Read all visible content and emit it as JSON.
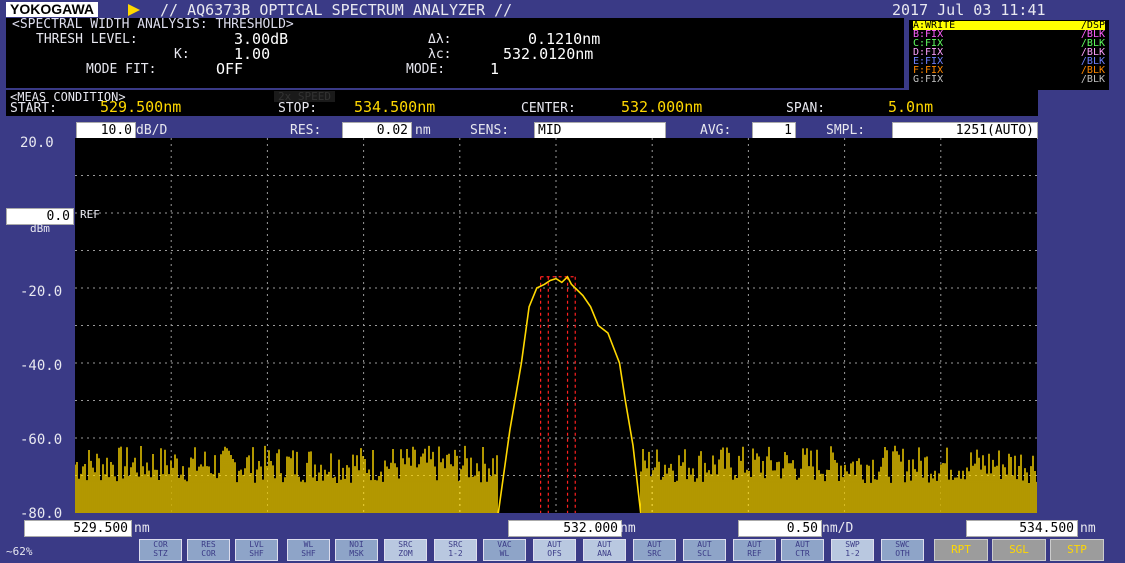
{
  "header": {
    "brand": "YOKOGAWA",
    "title": "// AQ6373B OPTICAL SPECTRUM ANALYZER //",
    "datetime": "2017 Jul 03 11:41"
  },
  "analysis": {
    "heading": "<SPECTRAL WIDTH ANALYSIS: THRESHOLD>",
    "thresh_level_label": "THRESH LEVEL:",
    "thresh_level": "3.00dB",
    "k_label": "K:",
    "k": "1.00",
    "mode_fit_label": "MODE FIT:",
    "mode_fit": "OFF",
    "delta_lambda_label": "Δλ:",
    "delta_lambda": "0.1210nm",
    "lambda_c_label": "λc:",
    "lambda_c": "532.0120nm",
    "mode_label": "MODE:",
    "mode": "1"
  },
  "legend": [
    {
      "label": "A:WRITE",
      "state": "/DSP"
    },
    {
      "label": "B:FIX",
      "state": "/BLK"
    },
    {
      "label": "C:FIX",
      "state": "/BLK"
    },
    {
      "label": "D:FIX",
      "state": "/BLK"
    },
    {
      "label": "E:FIX",
      "state": "/BLK"
    },
    {
      "label": "F:FIX",
      "state": "/BLK"
    },
    {
      "label": "G:FIX",
      "state": "/BLK"
    }
  ],
  "meas": {
    "heading": "<MEAS CONDITION>",
    "speed": "2x SPEED",
    "start_label": "START:",
    "start": "529.500nm",
    "stop_label": "STOP:",
    "stop": "534.500nm",
    "center_label": "CENTER:",
    "center": "532.000nm",
    "span_label": "SPAN:",
    "span": "5.0nm"
  },
  "params": {
    "scale": "10.0",
    "scale_unit": "dB/D",
    "res_label": "RES:",
    "res": "0.02",
    "res_unit": "nm",
    "sens_label": "SENS:",
    "sens": "MID",
    "avg_label": "AVG:",
    "avg": "1",
    "smpl_label": "SMPL:",
    "smpl": "1251(AUTO)"
  },
  "axis": {
    "y_ticks": [
      "20.0",
      "-20.0",
      "-40.0",
      "-60.0",
      "-80.0"
    ],
    "ref_level": "0.0",
    "ref_unit": "dBm",
    "ref_label": "REF"
  },
  "xaxis": {
    "start": "529.500",
    "center": "532.000",
    "stop": "534.500",
    "unit": "nm",
    "scale": "0.50",
    "scale_unit": "nm/D"
  },
  "chart_data": {
    "type": "line",
    "xlim": [
      529.5,
      534.5
    ],
    "ylim": [
      -80,
      20
    ],
    "x_divisions": 10,
    "y_divisions": 10,
    "trace_color": "#ffd800",
    "marker_color": "#ff2020",
    "noise_floor_dBm": [
      -72,
      -62
    ],
    "series": [
      {
        "x": [
          531.7,
          531.76,
          531.82,
          531.86,
          531.9,
          531.94,
          531.97,
          532.0,
          532.03,
          532.06,
          532.08,
          532.1,
          532.14,
          532.18,
          532.22,
          532.27,
          532.3,
          532.33,
          532.36,
          532.4,
          532.44
        ],
        "y": [
          -80,
          -58,
          -40,
          -25,
          -20,
          -19,
          -18,
          -17.5,
          -18.5,
          -17,
          -19,
          -20,
          -22,
          -25,
          -30,
          -32,
          -36,
          -40,
          -50,
          -62,
          -80
        ]
      }
    ],
    "threshold_markers_nm": [
      531.92,
      531.96,
      532.06,
      532.1
    ],
    "threshold_marker_level_dBm": -17
  },
  "softkeys": [
    {
      "l1": "COR",
      "l2": "STZ"
    },
    {
      "l1": "RES",
      "l2": "COR"
    },
    {
      "l1": "LVL",
      "l2": "SHF"
    },
    {
      "l1": "WL",
      "l2": "SHF"
    },
    {
      "l1": "NOI",
      "l2": "MSK"
    },
    {
      "l1": "SRC",
      "l2": "ZOM"
    },
    {
      "l1": "SRC",
      "l2": "1-2"
    },
    {
      "l1": "VAC",
      "l2": "WL"
    },
    {
      "l1": "AUT",
      "l2": "OFS"
    },
    {
      "l1": "AUT",
      "l2": "ANA"
    },
    {
      "l1": "AUT",
      "l2": "SRC"
    },
    {
      "l1": "AUT",
      "l2": "SCL"
    },
    {
      "l1": "AUT",
      "l2": "REF"
    },
    {
      "l1": "AUT",
      "l2": "CTR"
    },
    {
      "l1": "SWP",
      "l2": "1-2"
    },
    {
      "l1": "SWC",
      "l2": "OTH"
    }
  ],
  "footer": {
    "status": "~62%",
    "rpt": "RPT",
    "sgl": "SGL",
    "stp": "STP"
  }
}
